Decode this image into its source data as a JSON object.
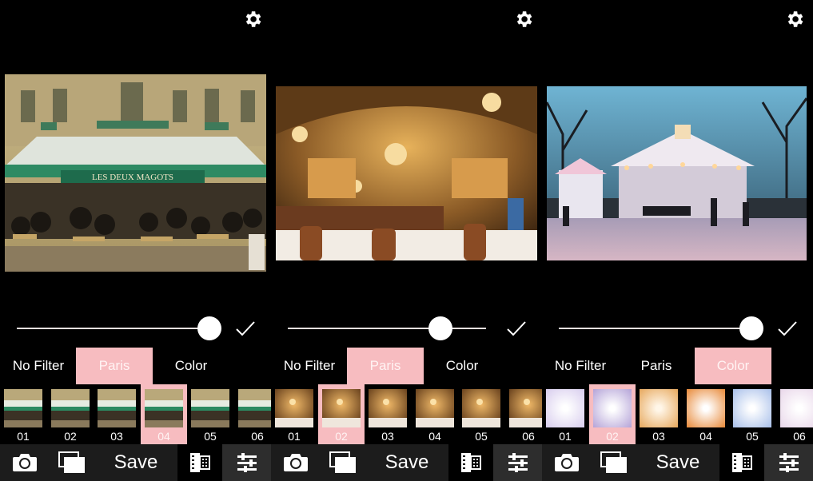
{
  "colors": {
    "accent_pink": "#f7bcc0",
    "background": "#000000",
    "toolbar": "#1c1c1c",
    "toolbar_active": "#2d2d2d"
  },
  "panels": [
    {
      "photo_subject": "cafe-storefront",
      "slider_value_pct": 97,
      "tabs": [
        "No Filter",
        "Paris",
        "Color"
      ],
      "selected_tab": 1,
      "thumbs": [
        "01",
        "02",
        "03",
        "04",
        "05",
        "06"
      ],
      "selected_thumb": 3,
      "thumb_style": "cafe",
      "toolbar": {
        "save_label": "Save"
      }
    },
    {
      "photo_subject": "ornate-restaurant-interior",
      "slider_value_pct": 77,
      "tabs": [
        "No Filter",
        "Paris",
        "Color"
      ],
      "selected_tab": 1,
      "thumbs": [
        "01",
        "02",
        "03",
        "04",
        "05",
        "06"
      ],
      "selected_thumb": 1,
      "thumb_style": "restaurant",
      "toolbar": {
        "save_label": "Save"
      }
    },
    {
      "photo_subject": "carousel-winter-park",
      "slider_value_pct": 97,
      "tabs": [
        "No Filter",
        "Paris",
        "Color"
      ],
      "selected_tab": 2,
      "thumbs": [
        "01",
        "02",
        "03",
        "04",
        "05",
        "06"
      ],
      "selected_thumb": 1,
      "thumb_style": "color",
      "toolbar": {
        "save_label": "Save"
      }
    }
  ],
  "icons": [
    "gear-icon",
    "checkmark-icon",
    "camera-icon",
    "layers-icon",
    "film-icon",
    "sliders-icon"
  ]
}
